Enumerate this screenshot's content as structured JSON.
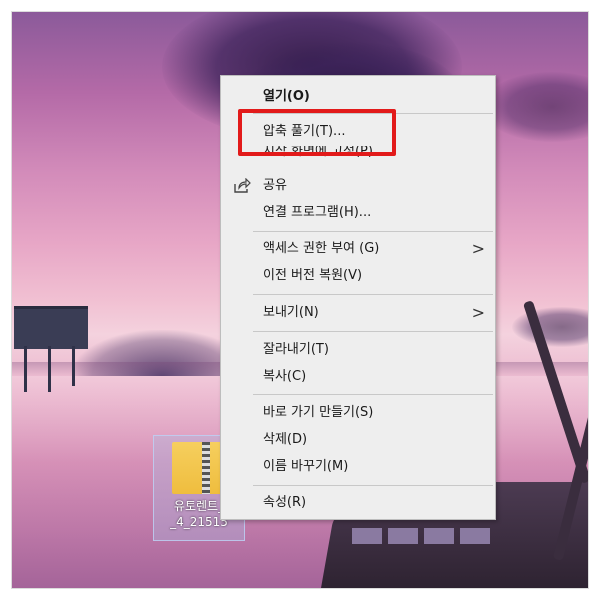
{
  "desktop": {
    "file": {
      "name_line1": "유토렌트_",
      "name_line2": "_4_21515"
    }
  },
  "context_menu": {
    "items": [
      {
        "label": "열기(O)"
      },
      {
        "label": "압축 풀기(T)..."
      },
      {
        "label": "시작 화면에 고정(P)"
      },
      {
        "label": "공유",
        "icon": "share-icon"
      },
      {
        "label": "연결 프로그램(H)..."
      },
      {
        "label": "액세스 권한 부여 (G)",
        "submenu": true
      },
      {
        "label": "이전 버전 복원(V)"
      },
      {
        "label": "보내기(N)",
        "submenu": true
      },
      {
        "label": "잘라내기(T)"
      },
      {
        "label": "복사(C)"
      },
      {
        "label": "바로 가기 만들기(S)"
      },
      {
        "label": "삭제(D)"
      },
      {
        "label": "이름 바꾸기(M)"
      },
      {
        "label": "속성(R)"
      }
    ],
    "submenu_arrow": ">",
    "highlight_color": "#e21a1a"
  }
}
